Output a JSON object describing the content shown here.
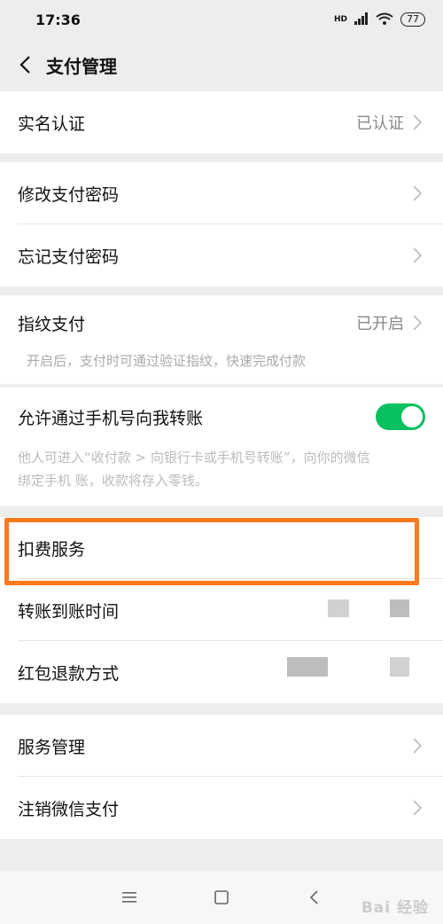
{
  "status": {
    "time": "17:36",
    "network": "HD",
    "battery": "77"
  },
  "header": {
    "title": "支付管理"
  },
  "group1": {
    "items": [
      {
        "label": "实名认证",
        "value": "已认证"
      }
    ]
  },
  "group2": {
    "items": [
      {
        "label": "修改支付密码"
      },
      {
        "label": "忘记支付密码"
      }
    ]
  },
  "group3": {
    "label": "指纹支付",
    "value": "已开启",
    "desc": "开启后，支付时可通过验证指纹，快速完成付款"
  },
  "group4": {
    "label": "允许通过手机号向我转账",
    "toggle_on": true,
    "desc_line1": "他人可进入“收付款 > 向银行卡或手机号转账”，向你的微信",
    "desc_line2": "绑定手机          账，收款将存入零钱。"
  },
  "group5": {
    "items": [
      {
        "label": "扣费服务"
      },
      {
        "label": "转账到账时间"
      },
      {
        "label": "红包退款方式"
      }
    ]
  },
  "group6": {
    "items": [
      {
        "label": "服务管理"
      },
      {
        "label": "注销微信支付"
      }
    ]
  },
  "watermark": "Bai 经验",
  "colors": {
    "accent": "#07c160",
    "highlight": "#ff7a1f"
  }
}
